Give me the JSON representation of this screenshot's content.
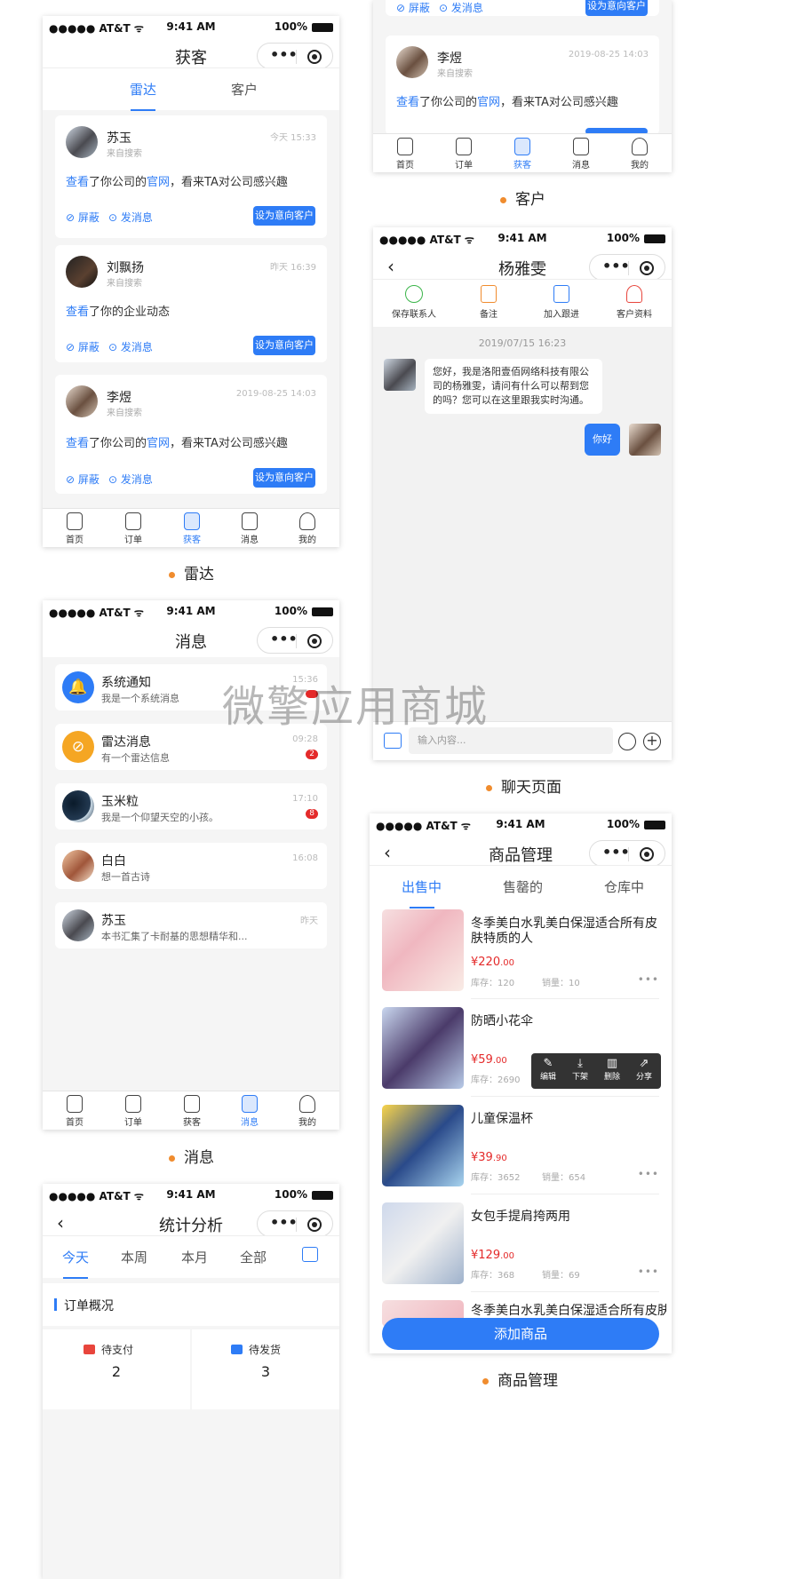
{
  "status": {
    "carrier": "●●●●● AT&T ᯤ",
    "time": "9:41 AM",
    "battery": "100%"
  },
  "capsule": {
    "dots": "•••"
  },
  "tabbar": {
    "home": "首页",
    "order": "订单",
    "acquire": "获客",
    "msg": "消息",
    "mine": "我的"
  },
  "radar": {
    "title": "获客",
    "tabs": [
      "雷达",
      "客户"
    ],
    "caption": "雷达",
    "cards": [
      {
        "name": "苏玉",
        "sub": "来自搜索",
        "time": "今天 15:33",
        "msg_pre": "查看",
        "msg_mid": "了你公司的",
        "msg_link": "官网",
        "msg_post": "，看来TA对公司感兴趣",
        "block": "屏蔽",
        "send": "发消息",
        "set": "设为意向客户"
      },
      {
        "name": "刘飘扬",
        "sub": "来自搜索",
        "time": "昨天 16:39",
        "msg_pre": "查看",
        "msg_mid": "了你的企业动态",
        "msg_link": "",
        "msg_post": "",
        "block": "屏蔽",
        "send": "发消息",
        "set": "设为意向客户"
      },
      {
        "name": "李煜",
        "sub": "来自搜索",
        "time": "2019-08-25 14:03",
        "msg_pre": "查看",
        "msg_mid": "了你公司的",
        "msg_link": "官网",
        "msg_post": "，看来TA对公司感兴趣",
        "block": "屏蔽",
        "send": "发消息",
        "set": "设为意向客户"
      }
    ]
  },
  "customer": {
    "caption": "客户",
    "top_block": "屏蔽",
    "top_send": "发消息",
    "top_set": "设为意向客户",
    "card": {
      "name": "李煜",
      "sub": "来自搜索",
      "time": "2019-08-25 14:03",
      "msg_pre": "查看",
      "msg_mid": "了你公司的",
      "msg_link": "官网",
      "msg_post": "，看来TA对公司感兴趣"
    }
  },
  "messages": {
    "title": "消息",
    "caption": "消息",
    "items": [
      {
        "name": "系统通知",
        "text": "我是一个系统消息",
        "time": "15:36",
        "badge": ""
      },
      {
        "name": "雷达消息",
        "text": "有一个雷达信息",
        "time": "09:28",
        "badge": "2"
      },
      {
        "name": "玉米粒",
        "text": "我是一个仰望天空的小孩。",
        "time": "17:10",
        "badge": "8"
      },
      {
        "name": "白白",
        "text": "想一首古诗",
        "time": "16:08",
        "badge": ""
      },
      {
        "name": "苏玉",
        "text": "本书汇集了卡耐基的思想精华和...",
        "time": "昨天",
        "badge": ""
      }
    ]
  },
  "chat": {
    "title": "杨雅雯",
    "caption": "聊天页面",
    "actions": [
      "保存联系人",
      "备注",
      "加入跟进",
      "客户资料"
    ],
    "date": "2019/07/15 16:23",
    "incoming": "您好，我是洛阳壹佰网络科技有限公司的杨雅雯，请问有什么可以帮到您的吗？您可以在这里跟我实时沟通。",
    "outgoing": "你好",
    "input_placeholder": "输入内容..."
  },
  "stats": {
    "title": "统计分析",
    "tabs": [
      "今天",
      "本周",
      "本月",
      "全部"
    ],
    "section": "订单概况",
    "items": [
      {
        "label": "待支付",
        "value": "2"
      },
      {
        "label": "待发货",
        "value": "3"
      }
    ]
  },
  "goods": {
    "title": "商品管理",
    "caption": "商品管理",
    "tabs": [
      "出售中",
      "售罄的",
      "仓库中"
    ],
    "products": [
      {
        "title": "冬季美白水乳美白保湿适合所有皮肤特质的人",
        "price_int": "¥220",
        "price_dec": ".00",
        "stock": "库存：120",
        "sales": "销量：10"
      },
      {
        "title": "防晒小花伞",
        "price_int": "¥59",
        "price_dec": ".00",
        "stock": "库存：2690",
        "sales": ""
      },
      {
        "title": "儿童保温杯",
        "price_int": "¥39",
        "price_dec": ".90",
        "stock": "库存：3652",
        "sales": "销量：654"
      },
      {
        "title": "女包手提肩挎两用",
        "price_int": "¥129",
        "price_dec": ".00",
        "stock": "库存：368",
        "sales": "销量：69"
      },
      {
        "title": "冬季美白水乳美白保湿适合所有皮肤",
        "price_int": "",
        "price_dec": "",
        "stock": "",
        "sales": ""
      }
    ],
    "menu": [
      "编辑",
      "下架",
      "删除",
      "分享"
    ],
    "add": "添加商品"
  },
  "watermark": "微擎应用商城",
  "colors": {
    "primary": "#2e7cf6",
    "accent": "#f08c2e",
    "danger": "#e42a2a"
  }
}
